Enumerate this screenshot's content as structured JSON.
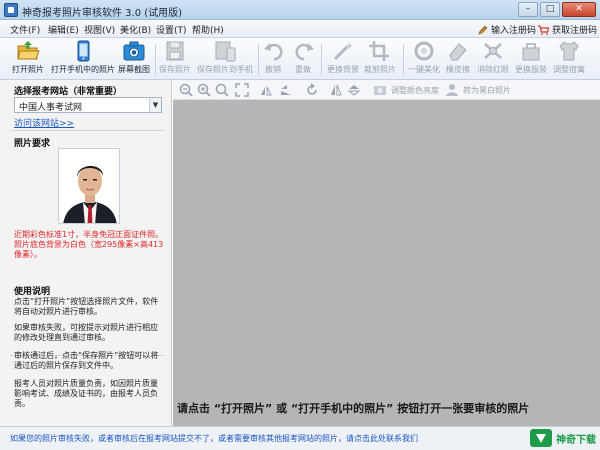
{
  "window": {
    "title": "神奇报考照片审核软件 3.0 (试用版)",
    "buttons": [
      "min",
      "max",
      "close"
    ]
  },
  "menu": {
    "items": [
      "文件(F)",
      "编辑(E)",
      "视图(V)",
      "美化(B)",
      "设置(T)",
      "帮助(H)"
    ],
    "register_code": "输入注册码",
    "get_register_code": "获取注册码"
  },
  "toolbar": {
    "items": [
      {
        "label": "打开照片",
        "icon": "folder-open-icon",
        "state": "active"
      },
      {
        "label": "打开手机中的照片",
        "icon": "phone-icon",
        "state": "active"
      },
      {
        "label": "屏幕截图",
        "icon": "camera-icon",
        "state": "active"
      },
      {
        "label": "保存照片",
        "icon": "save-icon",
        "state": "disabled"
      },
      {
        "label": "保存照片到手机",
        "icon": "save-phone-icon",
        "state": "disabled"
      },
      {
        "label": "撤销",
        "icon": "undo-icon",
        "state": "disabled"
      },
      {
        "label": "重做",
        "icon": "redo-icon",
        "state": "disabled"
      },
      {
        "label": "更换背景",
        "icon": "magic-wand-icon",
        "state": "disabled"
      },
      {
        "label": "裁剪照片",
        "icon": "crop-icon",
        "state": "disabled"
      },
      {
        "label": "一键美化",
        "icon": "beautify-icon",
        "state": "disabled"
      },
      {
        "label": "橡皮擦",
        "icon": "eraser-icon",
        "state": "disabled"
      },
      {
        "label": "消除红眼",
        "icon": "red-eye-icon",
        "state": "disabled"
      },
      {
        "label": "更换服装",
        "icon": "clothes-icon",
        "state": "disabled"
      },
      {
        "label": "调整宿寓",
        "icon": "shirt-icon",
        "state": "disabled"
      }
    ]
  },
  "left": {
    "select_site_title": "选择报考网站（非常重要）",
    "site_selected": "中国人事考试网",
    "visit_site": "访问该网站>>",
    "photo_req_title": "照片要求",
    "photo_req_text": "近期彩色标准1寸，半身免冠正面证件照。照片底色背景为白色（宽295像素×高413像素）。",
    "usage_title": "使用说明",
    "usage_paragraphs": [
      "点击“打开照片”按钮选择照片文件，软件将自动对照片进行审核。",
      "如果审核失败，可按提示对照片进行相应的修改处理直到通过审核。",
      "审核通过后，点击“保存照片”按钮可以将通过后的照片保存到文件中。",
      "报考人员对照片质量负责，如因照片质量影响考试、成绩及证书的，由报考人员负责。"
    ]
  },
  "view_toolbar": {
    "icons": [
      "zoom-out-icon",
      "zoom-in-icon",
      "zoom-fit-icon",
      "fullscreen-icon",
      "flip-h-icon",
      "flip-v-icon",
      "rotate-icon",
      "mirror-icon",
      "mirror-v-icon"
    ],
    "adjust_color": "调整颜色亮度",
    "to_bw": "转为黑白照片"
  },
  "canvas": {
    "hint": "请点击 “打开照片” 或 “打开手机中的照片” 按钮打开一张要审核的照片"
  },
  "status": {
    "text": "如果您的照片审核失败，或者审核后在报考网站提交不了，或者需要审核其他报考网站的照片，请点击此处联系我们"
  },
  "watermark": {
    "text": "神奇下载"
  },
  "colors": {
    "accent": "#1a55c4",
    "warning": "#e0262a",
    "canvas_gray": "#b5b5b5",
    "watermark_green": "#1f9b4a"
  }
}
